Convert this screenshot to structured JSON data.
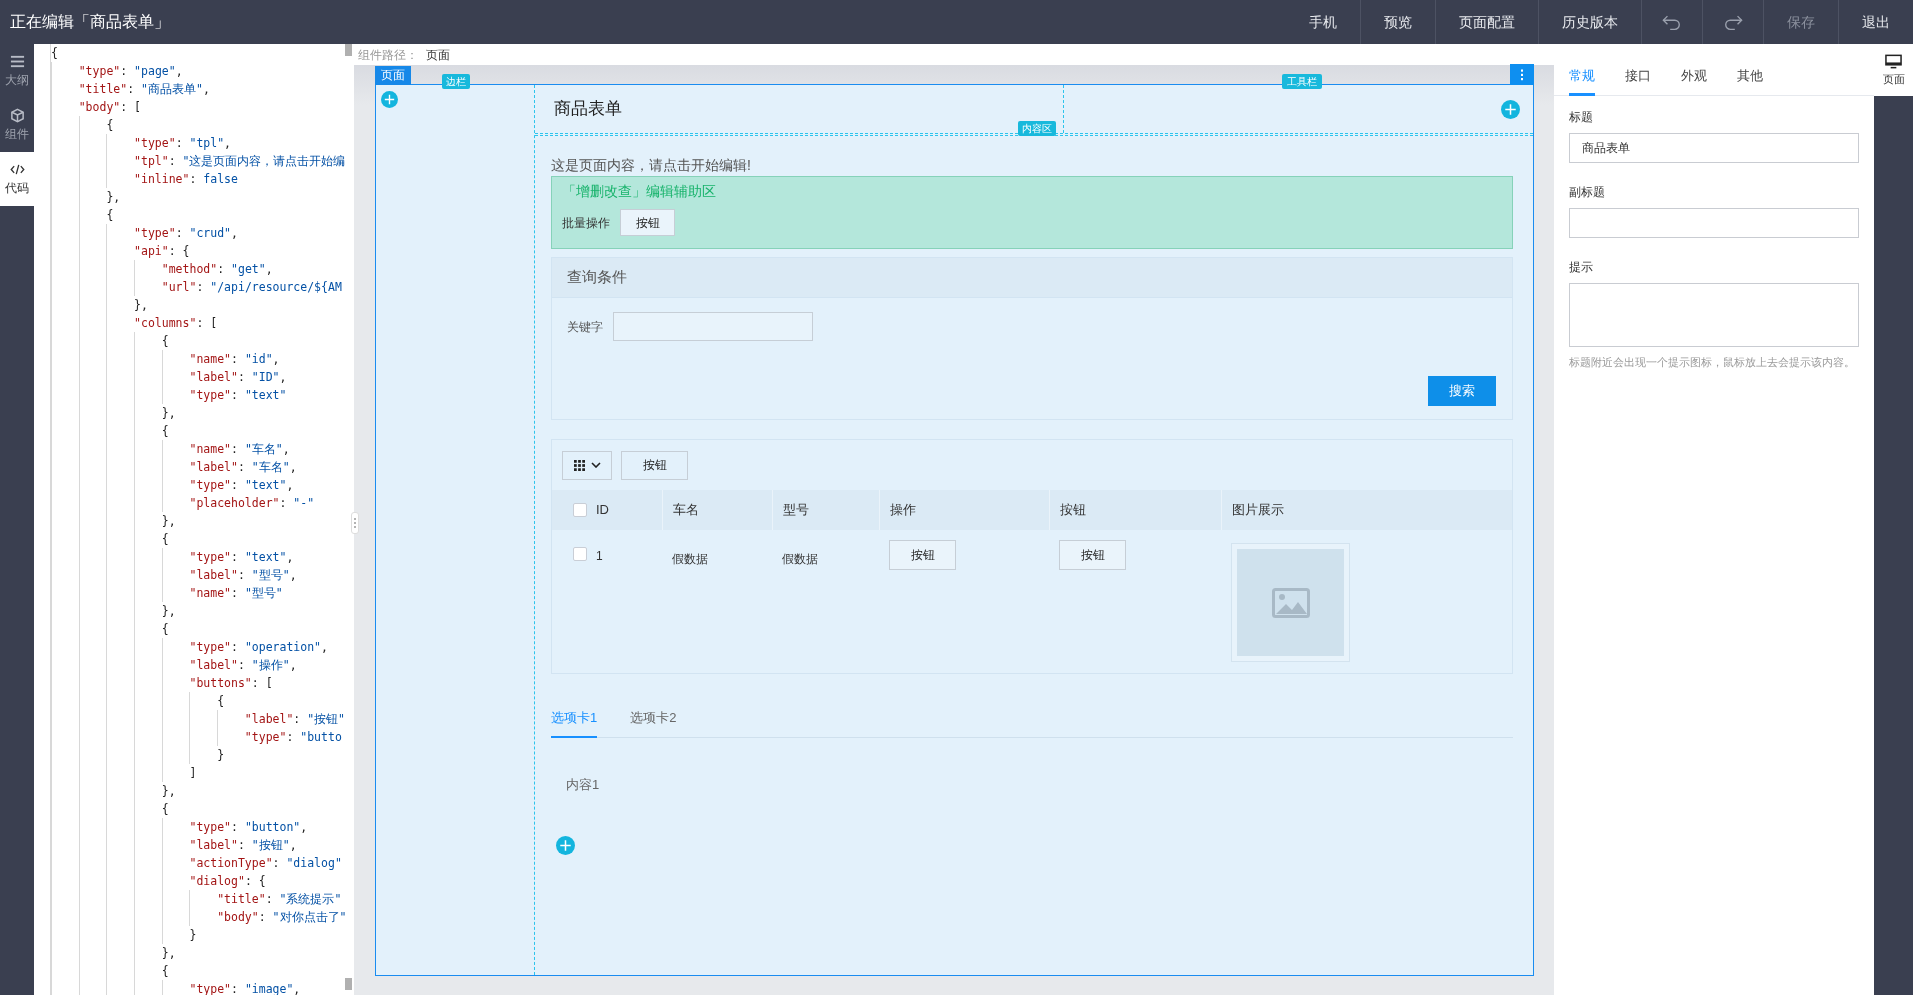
{
  "header": {
    "title": "正在编辑「商品表单」",
    "actions": [
      {
        "kind": "text",
        "label": "手机",
        "disabled": false
      },
      {
        "kind": "text",
        "label": "预览",
        "disabled": false
      },
      {
        "kind": "text",
        "label": "页面配置",
        "disabled": false
      },
      {
        "kind": "text",
        "label": "历史版本",
        "disabled": false
      },
      {
        "kind": "undo",
        "disabled": false
      },
      {
        "kind": "redo",
        "disabled": false
      },
      {
        "kind": "text",
        "label": "保存",
        "disabled": true
      },
      {
        "kind": "text",
        "label": "退出",
        "disabled": false
      }
    ]
  },
  "rail": [
    {
      "kind": "outline",
      "label": "大纲",
      "selected": false
    },
    {
      "kind": "components",
      "label": "组件",
      "selected": false
    },
    {
      "kind": "code",
      "label": "代码",
      "selected": true
    }
  ],
  "code": {
    "lines": [
      {
        "tokens": [
          {
            "kind": "punct",
            "text": "{"
          }
        ]
      },
      {
        "tokens": [
          {
            "kind": "key",
            "text": "    \"type\""
          },
          {
            "kind": "punct",
            "text": ": "
          },
          {
            "kind": "string",
            "text": "\"page\""
          },
          {
            "kind": "punct",
            "text": ","
          }
        ]
      },
      {
        "tokens": [
          {
            "kind": "key",
            "text": "    \"title\""
          },
          {
            "kind": "punct",
            "text": ": "
          },
          {
            "kind": "string",
            "text": "\"商品表单\""
          },
          {
            "kind": "punct",
            "text": ","
          }
        ]
      },
      {
        "tokens": [
          {
            "kind": "key",
            "text": "    \"body\""
          },
          {
            "kind": "punct",
            "text": ": ["
          }
        ]
      },
      {
        "tokens": [
          {
            "kind": "punct",
            "text": "        {"
          }
        ]
      },
      {
        "tokens": [
          {
            "kind": "key",
            "text": "            \"type\""
          },
          {
            "kind": "punct",
            "text": ": "
          },
          {
            "kind": "string",
            "text": "\"tpl\""
          },
          {
            "kind": "punct",
            "text": ","
          }
        ]
      },
      {
        "tokens": [
          {
            "kind": "key",
            "text": "            \"tpl\""
          },
          {
            "kind": "punct",
            "text": ": "
          },
          {
            "kind": "string",
            "text": "\"这是页面内容，请点击开始编"
          }
        ]
      },
      {
        "tokens": [
          {
            "kind": "key",
            "text": "            \"inline\""
          },
          {
            "kind": "punct",
            "text": ": "
          },
          {
            "kind": "literal",
            "text": "false"
          }
        ]
      },
      {
        "tokens": [
          {
            "kind": "punct",
            "text": "        },"
          }
        ]
      },
      {
        "tokens": [
          {
            "kind": "punct",
            "text": "        {"
          }
        ]
      },
      {
        "tokens": [
          {
            "kind": "key",
            "text": "            \"type\""
          },
          {
            "kind": "punct",
            "text": ": "
          },
          {
            "kind": "string",
            "text": "\"crud\""
          },
          {
            "kind": "punct",
            "text": ","
          }
        ]
      },
      {
        "tokens": [
          {
            "kind": "key",
            "text": "            \"api\""
          },
          {
            "kind": "punct",
            "text": ": {"
          }
        ]
      },
      {
        "tokens": [
          {
            "kind": "key",
            "text": "                \"method\""
          },
          {
            "kind": "punct",
            "text": ": "
          },
          {
            "kind": "string",
            "text": "\"get\""
          },
          {
            "kind": "punct",
            "text": ","
          }
        ]
      },
      {
        "tokens": [
          {
            "kind": "key",
            "text": "                \"url\""
          },
          {
            "kind": "punct",
            "text": ": "
          },
          {
            "kind": "string",
            "text": "\"/api/resource/${AM"
          }
        ]
      },
      {
        "tokens": [
          {
            "kind": "punct",
            "text": "            },"
          }
        ]
      },
      {
        "tokens": [
          {
            "kind": "key",
            "text": "            \"columns\""
          },
          {
            "kind": "punct",
            "text": ": ["
          }
        ]
      },
      {
        "tokens": [
          {
            "kind": "punct",
            "text": "                {"
          }
        ]
      },
      {
        "tokens": [
          {
            "kind": "key",
            "text": "                    \"name\""
          },
          {
            "kind": "punct",
            "text": ": "
          },
          {
            "kind": "string",
            "text": "\"id\""
          },
          {
            "kind": "punct",
            "text": ","
          }
        ]
      },
      {
        "tokens": [
          {
            "kind": "key",
            "text": "                    \"label\""
          },
          {
            "kind": "punct",
            "text": ": "
          },
          {
            "kind": "string",
            "text": "\"ID\""
          },
          {
            "kind": "punct",
            "text": ","
          }
        ]
      },
      {
        "tokens": [
          {
            "kind": "key",
            "text": "                    \"type\""
          },
          {
            "kind": "punct",
            "text": ": "
          },
          {
            "kind": "string",
            "text": "\"text\""
          }
        ]
      },
      {
        "tokens": [
          {
            "kind": "punct",
            "text": "                },"
          }
        ]
      },
      {
        "tokens": [
          {
            "kind": "punct",
            "text": "                {"
          }
        ]
      },
      {
        "tokens": [
          {
            "kind": "key",
            "text": "                    \"name\""
          },
          {
            "kind": "punct",
            "text": ": "
          },
          {
            "kind": "string",
            "text": "\"车名\""
          },
          {
            "kind": "punct",
            "text": ","
          }
        ]
      },
      {
        "tokens": [
          {
            "kind": "key",
            "text": "                    \"label\""
          },
          {
            "kind": "punct",
            "text": ": "
          },
          {
            "kind": "string",
            "text": "\"车名\""
          },
          {
            "kind": "punct",
            "text": ","
          }
        ]
      },
      {
        "tokens": [
          {
            "kind": "key",
            "text": "                    \"type\""
          },
          {
            "kind": "punct",
            "text": ": "
          },
          {
            "kind": "string",
            "text": "\"text\""
          },
          {
            "kind": "punct",
            "text": ","
          }
        ]
      },
      {
        "tokens": [
          {
            "kind": "key",
            "text": "                    \"placeholder\""
          },
          {
            "kind": "punct",
            "text": ": "
          },
          {
            "kind": "string",
            "text": "\"-\""
          }
        ]
      },
      {
        "tokens": [
          {
            "kind": "punct",
            "text": "                },"
          }
        ]
      },
      {
        "tokens": [
          {
            "kind": "punct",
            "text": "                {"
          }
        ]
      },
      {
        "tokens": [
          {
            "kind": "key",
            "text": "                    \"type\""
          },
          {
            "kind": "punct",
            "text": ": "
          },
          {
            "kind": "string",
            "text": "\"text\""
          },
          {
            "kind": "punct",
            "text": ","
          }
        ]
      },
      {
        "tokens": [
          {
            "kind": "key",
            "text": "                    \"label\""
          },
          {
            "kind": "punct",
            "text": ": "
          },
          {
            "kind": "string",
            "text": "\"型号\""
          },
          {
            "kind": "punct",
            "text": ","
          }
        ]
      },
      {
        "tokens": [
          {
            "kind": "key",
            "text": "                    \"name\""
          },
          {
            "kind": "punct",
            "text": ": "
          },
          {
            "kind": "string",
            "text": "\"型号\""
          }
        ]
      },
      {
        "tokens": [
          {
            "kind": "punct",
            "text": "                },"
          }
        ]
      },
      {
        "tokens": [
          {
            "kind": "punct",
            "text": "                {"
          }
        ]
      },
      {
        "tokens": [
          {
            "kind": "key",
            "text": "                    \"type\""
          },
          {
            "kind": "punct",
            "text": ": "
          },
          {
            "kind": "string",
            "text": "\"operation\""
          },
          {
            "kind": "punct",
            "text": ","
          }
        ]
      },
      {
        "tokens": [
          {
            "kind": "key",
            "text": "                    \"label\""
          },
          {
            "kind": "punct",
            "text": ": "
          },
          {
            "kind": "string",
            "text": "\"操作\""
          },
          {
            "kind": "punct",
            "text": ","
          }
        ]
      },
      {
        "tokens": [
          {
            "kind": "key",
            "text": "                    \"buttons\""
          },
          {
            "kind": "punct",
            "text": ": ["
          }
        ]
      },
      {
        "tokens": [
          {
            "kind": "punct",
            "text": "                        {"
          }
        ]
      },
      {
        "tokens": [
          {
            "kind": "key",
            "text": "                            \"label\""
          },
          {
            "kind": "punct",
            "text": ": "
          },
          {
            "kind": "string",
            "text": "\"按钮\""
          }
        ]
      },
      {
        "tokens": [
          {
            "kind": "key",
            "text": "                            \"type\""
          },
          {
            "kind": "punct",
            "text": ": "
          },
          {
            "kind": "string",
            "text": "\"butto"
          }
        ]
      },
      {
        "tokens": [
          {
            "kind": "punct",
            "text": "                        }"
          }
        ]
      },
      {
        "tokens": [
          {
            "kind": "punct",
            "text": "                    ]"
          }
        ]
      },
      {
        "tokens": [
          {
            "kind": "punct",
            "text": "                },"
          }
        ]
      },
      {
        "tokens": [
          {
            "kind": "punct",
            "text": "                {"
          }
        ]
      },
      {
        "tokens": [
          {
            "kind": "key",
            "text": "                    \"type\""
          },
          {
            "kind": "punct",
            "text": ": "
          },
          {
            "kind": "string",
            "text": "\"button\""
          },
          {
            "kind": "punct",
            "text": ","
          }
        ]
      },
      {
        "tokens": [
          {
            "kind": "key",
            "text": "                    \"label\""
          },
          {
            "kind": "punct",
            "text": ": "
          },
          {
            "kind": "string",
            "text": "\"按钮\""
          },
          {
            "kind": "punct",
            "text": ","
          }
        ]
      },
      {
        "tokens": [
          {
            "kind": "key",
            "text": "                    \"actionType\""
          },
          {
            "kind": "punct",
            "text": ": "
          },
          {
            "kind": "string",
            "text": "\"dialog\""
          }
        ]
      },
      {
        "tokens": [
          {
            "kind": "key",
            "text": "                    \"dialog\""
          },
          {
            "kind": "punct",
            "text": ": {"
          }
        ]
      },
      {
        "tokens": [
          {
            "kind": "key",
            "text": "                        \"title\""
          },
          {
            "kind": "punct",
            "text": ": "
          },
          {
            "kind": "string",
            "text": "\"系统提示\""
          }
        ]
      },
      {
        "tokens": [
          {
            "kind": "key",
            "text": "                        \"body\""
          },
          {
            "kind": "punct",
            "text": ": "
          },
          {
            "kind": "string",
            "text": "\"对你点击了\""
          }
        ]
      },
      {
        "tokens": [
          {
            "kind": "punct",
            "text": "                    }"
          }
        ]
      },
      {
        "tokens": [
          {
            "kind": "punct",
            "text": "                },"
          }
        ]
      },
      {
        "tokens": [
          {
            "kind": "punct",
            "text": "                {"
          }
        ]
      },
      {
        "tokens": [
          {
            "kind": "key",
            "text": "                    \"type\""
          },
          {
            "kind": "punct",
            "text": ": "
          },
          {
            "kind": "string",
            "text": "\"image\""
          },
          {
            "kind": "punct",
            "text": ","
          }
        ]
      }
    ]
  },
  "breadcrumb": {
    "label": "组件路径：",
    "value": "页面"
  },
  "canvas": {
    "page_tag": "页面",
    "aside_tag": "边栏",
    "toolbar_tag": "工具栏",
    "body_tag": "内容区",
    "title": "商品表单",
    "intro": "这是页面内容，请点击开始编辑!",
    "crud_helper": {
      "title": "「增删改查」编辑辅助区",
      "bulk_label": "批量操作",
      "bulk_button": "按钮"
    },
    "query": {
      "title": "查询条件",
      "field_label": "关键字",
      "submit": "搜索"
    },
    "table": {
      "toolbar_button": "按钮",
      "header_checked": false,
      "columns": [
        "ID",
        "车名",
        "型号",
        "操作",
        "按钮",
        "图片展示"
      ],
      "rows": [
        {
          "checked": false,
          "cells": [
            {
              "kind": "text",
              "text": "1"
            },
            {
              "kind": "text",
              "text": "假数据"
            },
            {
              "kind": "text",
              "text": "假数据"
            },
            {
              "kind": "button",
              "text": "按钮"
            },
            {
              "kind": "button",
              "text": "按钮"
            },
            {
              "kind": "image"
            }
          ]
        }
      ]
    },
    "tabs": [
      {
        "label": "选项卡1",
        "selected": true
      },
      {
        "label": "选项卡2",
        "selected": false
      }
    ],
    "tab_content": "内容1"
  },
  "inspector": {
    "tabs": [
      {
        "label": "常规",
        "selected": true
      },
      {
        "label": "接口",
        "selected": false
      },
      {
        "label": "外观",
        "selected": false
      },
      {
        "label": "其他",
        "selected": false
      }
    ],
    "fields": [
      {
        "kind": "input",
        "label": "标题",
        "value": "商品表单"
      },
      {
        "kind": "input",
        "label": "副标题"
      },
      {
        "kind": "textarea",
        "label": "提示",
        "help": "标题附近会出现一个提示图标，鼠标放上去会提示该内容。"
      }
    ]
  },
  "side_rail": {
    "label": "页面",
    "selected": true
  }
}
